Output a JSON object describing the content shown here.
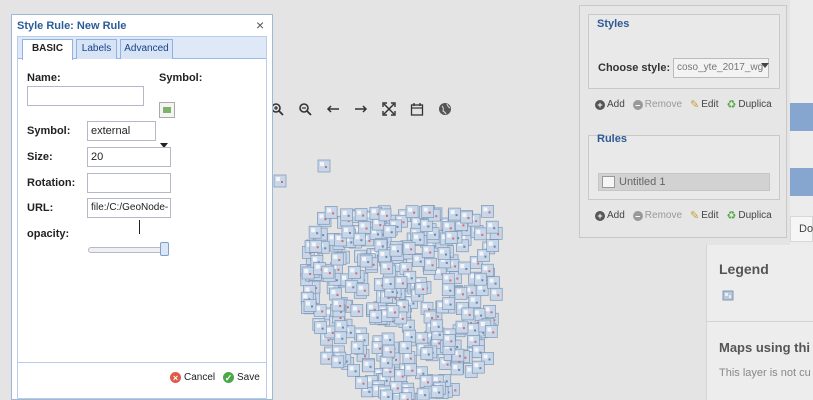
{
  "dialog": {
    "title": "Style Rule: New Rule",
    "tabs": [
      {
        "label": "BASIC",
        "active": true
      },
      {
        "label": "Labels",
        "active": false
      },
      {
        "label": "Advanced",
        "active": false
      }
    ],
    "fields": {
      "name_label": "Name:",
      "name_value": "",
      "symbol_header_label": "Symbol:",
      "symbol_label": "Symbol:",
      "symbol_value": "external",
      "size_label": "Size:",
      "size_value": "20",
      "rotation_label": "Rotation:",
      "rotation_value": "",
      "url_label": "URL:",
      "url_value": "file:/C:/GeoNode-",
      "opacity_label": "opacity:",
      "opacity_value": 1.0
    },
    "buttons": {
      "cancel": "Cancel",
      "save": "Save"
    }
  },
  "styles_panel": {
    "styles_legend": "Styles",
    "choose_label": "Choose style:",
    "choose_value": "coso_yte_2017_wg",
    "actions": {
      "add": "Add",
      "remove": "Remove",
      "edit": "Edit",
      "duplicate": "Duplica"
    },
    "rules_legend": "Rules",
    "rule_item": "Untitled 1"
  },
  "right_panel": {
    "tab_text": "Do",
    "legend_title": "Legend",
    "maps_title": "Maps using thi",
    "maps_text": "This layer is not cu"
  },
  "toolbar_icons": [
    "zoom-in-icon",
    "zoom-out-icon",
    "arrow-left-icon",
    "arrow-right-icon",
    "fullscreen-icon",
    "calendar-icon",
    "globe-icon"
  ],
  "colors": {
    "accent": "#2b5d9a",
    "tab_border": "#8db2e3",
    "side_button": "#86a6cf",
    "cancel": "#e05a4a",
    "save": "#4aa845"
  }
}
